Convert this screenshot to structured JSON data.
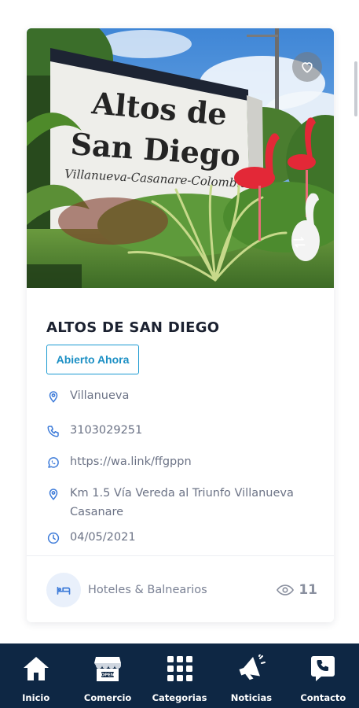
{
  "listing": {
    "title": "ALTOS DE SAN DIEGO",
    "status": "Abierto Ahora",
    "location": "Villanueva",
    "phone": "3103029251",
    "whatsapp": "https://wa.link/ffgppn",
    "address": "Km 1.5 Vía Vereda al Triunfo Villanueva Casanare",
    "date": "04/05/2021",
    "category": "Hoteles & Balnearios",
    "views": "11"
  },
  "hero": {
    "sign_line1": "Altos de",
    "sign_line2": "San Diego",
    "sign_line3": "Villanueva-Casanare-Colombia",
    "icons": {
      "favorite": "heart-icon",
      "swap": "swap-arrows-icon"
    }
  },
  "bottom_nav": [
    {
      "label": "Inicio",
      "icon": "home-icon"
    },
    {
      "label": "Comercio",
      "icon": "store-icon"
    },
    {
      "label": "Categorias",
      "icon": "grid-icon"
    },
    {
      "label": "Noticias",
      "icon": "megaphone-icon"
    },
    {
      "label": "Contacto",
      "icon": "phone-chat-icon"
    }
  ],
  "colors": {
    "accent": "#1b9ad1",
    "nav_bg": "#0e2744",
    "icon_blue": "#3d7bd9",
    "title": "#1b2130"
  }
}
